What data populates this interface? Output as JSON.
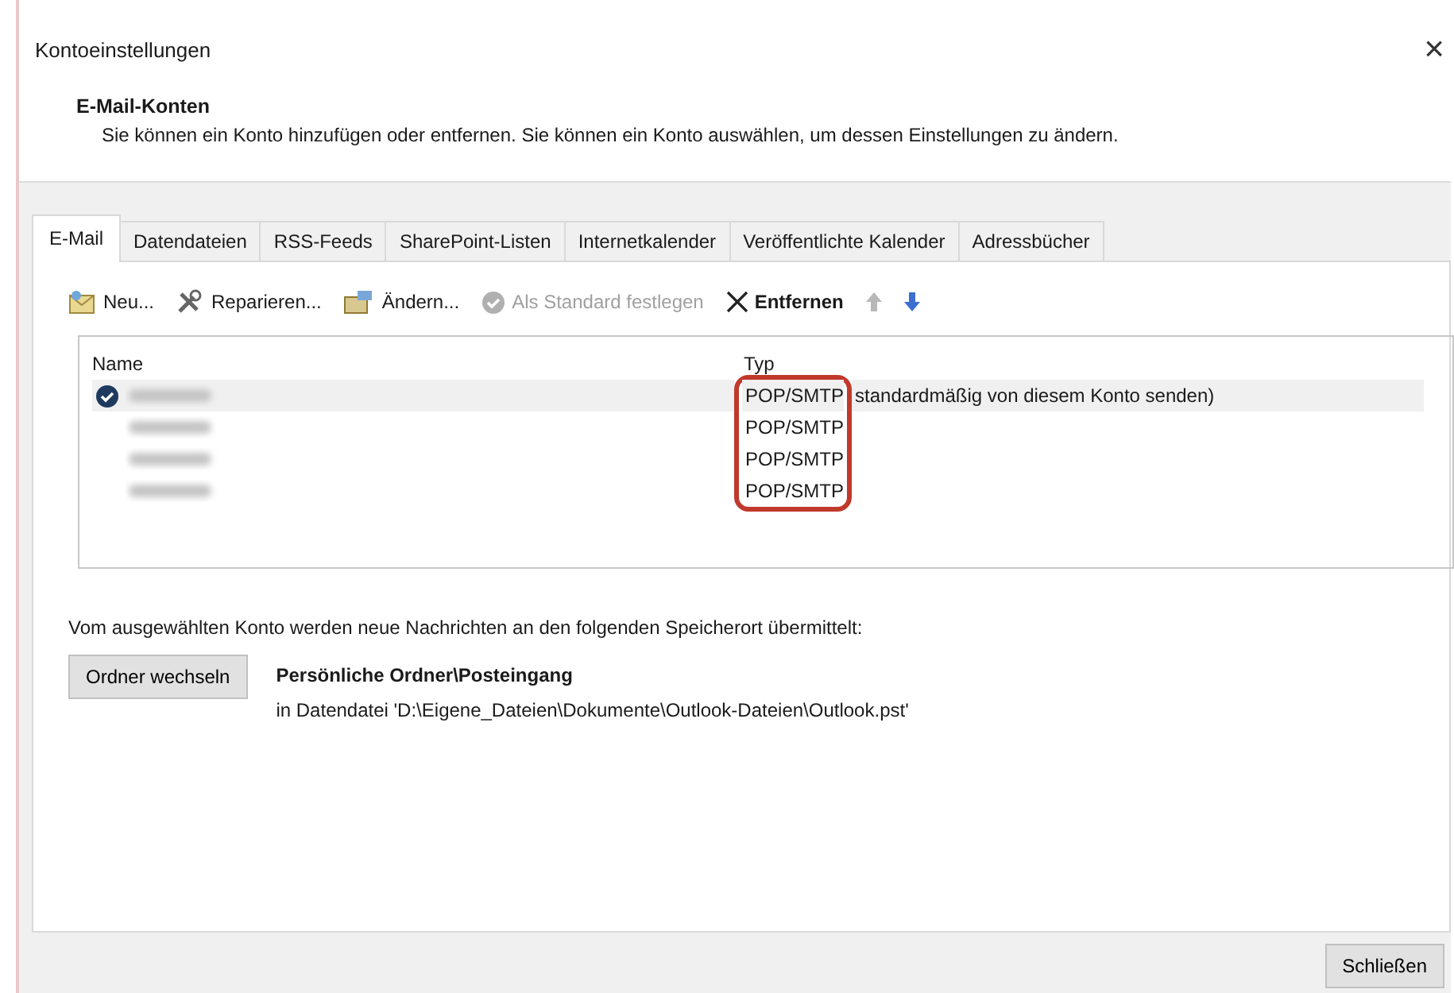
{
  "window": {
    "title": "Kontoeinstellungen",
    "close": "×"
  },
  "header": {
    "heading": "E-Mail-Konten",
    "description": "Sie können ein Konto hinzufügen oder entfernen. Sie können ein Konto auswählen, um dessen Einstellungen zu ändern."
  },
  "tabs": [
    {
      "label": "E-Mail",
      "selected": true
    },
    {
      "label": "Datendateien",
      "selected": false
    },
    {
      "label": "RSS-Feeds",
      "selected": false
    },
    {
      "label": "SharePoint-Listen",
      "selected": false
    },
    {
      "label": "Internetkalender",
      "selected": false
    },
    {
      "label": "Veröffentlichte Kalender",
      "selected": false
    },
    {
      "label": "Adressbücher",
      "selected": false
    }
  ],
  "toolbar": [
    {
      "kind": "new",
      "label": "Neu...",
      "disabled": false
    },
    {
      "kind": "repair",
      "label": "Reparieren...",
      "disabled": false
    },
    {
      "kind": "change",
      "label": "Ändern...",
      "disabled": false
    },
    {
      "kind": "default",
      "label": "Als Standard festlegen",
      "disabled": true
    },
    {
      "kind": "remove",
      "label": "Entfernen",
      "disabled": false
    },
    {
      "kind": "up",
      "disabled": true
    },
    {
      "kind": "down",
      "disabled": false
    }
  ],
  "table": {
    "columns": [
      "Name",
      "Typ"
    ],
    "type_column_highlighted": true,
    "rows": [
      {
        "type": "POP/SMTP",
        "default": true,
        "selected": true,
        "note": "standardmäßig von diesem Konto senden)"
      },
      {
        "type": "POP/SMTP",
        "default": false,
        "selected": false
      },
      {
        "type": "POP/SMTP",
        "default": false,
        "selected": false
      },
      {
        "type": "POP/SMTP",
        "default": false,
        "selected": false
      }
    ]
  },
  "delivery": {
    "text": "Vom ausgewählten Konto werden neue Nachrichten an den folgenden Speicherort übermittelt:",
    "button": "Ordner wechseln",
    "folder": "Persönliche Ordner\\Posteingang",
    "file": "in Datendatei 'D:\\Eigene_Dateien\\Dokumente\\Outlook-Dateien\\Outlook.pst'"
  },
  "footer": {
    "button": "Schließen"
  }
}
